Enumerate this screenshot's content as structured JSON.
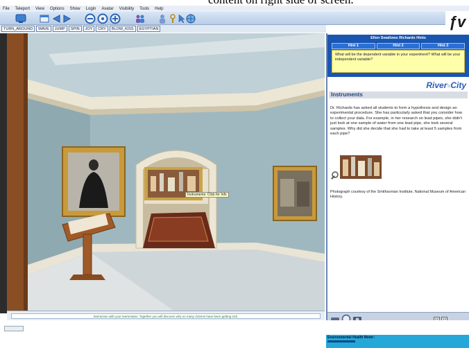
{
  "caption": {
    "text": "content on right side of screen."
  },
  "menu": [
    "File",
    "Teleport",
    "View",
    "Options",
    "Show",
    "Login",
    "Avatar",
    "Visibility",
    "Tools",
    "Help"
  ],
  "action_buttons": [
    "TURN_AROUND",
    "WAVE",
    "JUMP",
    "SPIN",
    "JOY",
    "CRY",
    "BLOW_KISS",
    "EGYPTIAN"
  ],
  "icons": {
    "toolbar": [
      "monitor-icon",
      "window-icon",
      "back-arrow-icon",
      "forward-arrow-icon",
      "zoom-out-icon",
      "zoom-reset-icon",
      "zoom-in-icon",
      "people-icon",
      "person-icon",
      "key-icon",
      "cursor-icon",
      "globe-icon"
    ],
    "footer": [
      "car-icon",
      "magnifier-icon",
      "camera-icon"
    ]
  },
  "viewport": {
    "tooltip": "Instruments: Click for Info"
  },
  "status_message": "Interaction with your teammates. Together you will discover why so many citizens have been getting sick.",
  "panel": {
    "hint_title": "Ellen Swallows Richards Hints",
    "hint_tabs": [
      "Hint 1",
      "Hint 2",
      "Hint 3"
    ],
    "hint_question": "What will be the dependent variable in your experiment? What will be your independent variable?",
    "brand_river": "River",
    "brand_city": "City",
    "section_title": "Instruments",
    "body": "Dr. Richards has asked all students to form a hypothesis and design an experimental procedure. She has particularly asked that you consider how to collect your data. For example, in her research on lead pipes, she didn't just look at one sample of water from one lead pipe, she took several samples. Why did she decide that she had to take at least 5 samples from each pipe?",
    "photo_credit": "Photograph courtesy of the Smithsonian Institute, National Museum of American History.",
    "pager_prev": "<<",
    "pager_next": ">>"
  },
  "news_label": "Environmental Health Meter:",
  "colors": {
    "hint_bg": "#1a56b0",
    "hint_question_bg": "#ffffaa",
    "brand": "#2a5cb8",
    "news_bg": "#25a7d8"
  }
}
